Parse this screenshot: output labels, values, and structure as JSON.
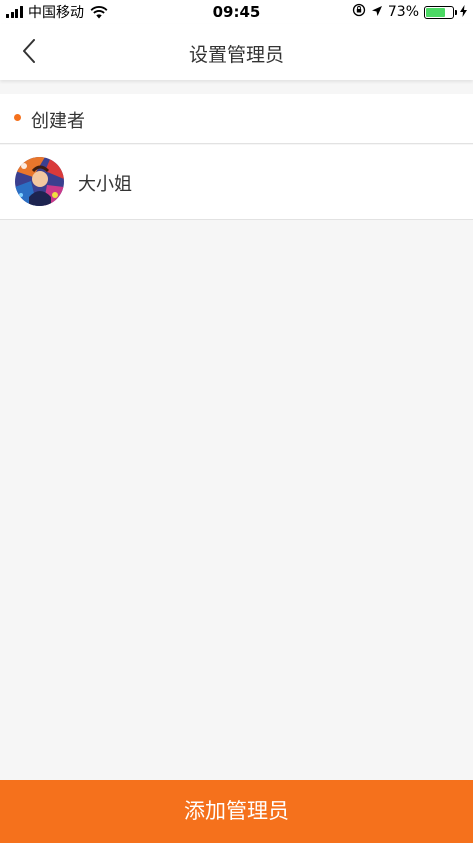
{
  "status_bar": {
    "carrier": "中国移动",
    "time": "09:45",
    "battery_percent": "73%",
    "battery_level": 0.73,
    "icons": [
      "signal-icon",
      "wifi-icon",
      "orientation-lock-icon",
      "location-icon",
      "battery-icon",
      "charging-icon"
    ]
  },
  "nav": {
    "title": "设置管理员",
    "back_icon": "chevron-left-icon"
  },
  "section": {
    "label": "创建者"
  },
  "members": [
    {
      "name": "大小姐",
      "avatar_icon": "avatar"
    }
  ],
  "footer": {
    "add_button_label": "添加管理员"
  },
  "colors": {
    "accent": "#f5711c",
    "background": "#f6f6f6",
    "text": "#333333"
  }
}
